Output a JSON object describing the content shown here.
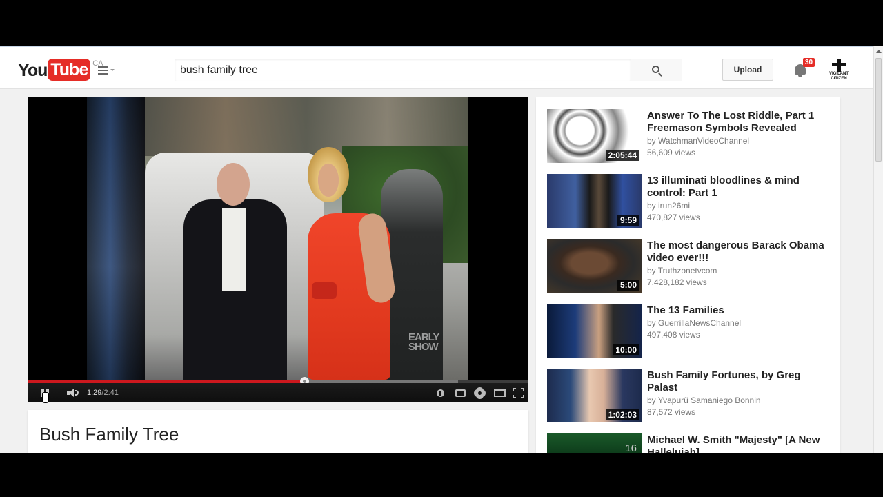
{
  "header": {
    "logo_you": "You",
    "logo_tube": "Tube",
    "region": "CA",
    "search_value": "bush family tree",
    "upload_label": "Upload",
    "notifications_count": "30",
    "avatar_text": "VIGILANT CITIZEN"
  },
  "player": {
    "current_time": "1:29",
    "separator": " / ",
    "duration": "2:41",
    "played_fraction": 0.553,
    "buffered_fraction": 0.86,
    "overlay_logo_line1": "EARLY",
    "overlay_logo_line2": "SHOW",
    "colors": {
      "played": "#cc181e",
      "buffer": "#777777"
    }
  },
  "video": {
    "title": "Bush Family Tree"
  },
  "related": [
    {
      "title": "Answer To The Lost Riddle, Part 1 Freemason Symbols Revealed",
      "channel": "by WatchmanVideoChannel",
      "views": "56,609 views",
      "duration": "2:05:44"
    },
    {
      "title": "13 illuminati bloodlines & mind control: Part 1",
      "channel": "by irun26mi",
      "views": "470,827 views",
      "duration": "9:59"
    },
    {
      "title": "The most dangerous Barack Obama video ever!!!",
      "channel": "by Truthzonetvcom",
      "views": "7,428,182 views",
      "duration": "5:00"
    },
    {
      "title": "The 13 Families",
      "channel": "by GuerrillaNewsChannel",
      "views": "497,408 views",
      "duration": "10:00"
    },
    {
      "title": "Bush Family Fortunes, by Greg Palast",
      "channel": "by Yvapurũ Samaniego Bonnin",
      "views": "87,572 views",
      "duration": "1:02:03"
    },
    {
      "title": "Michael W. Smith \"Majesty\" [A New Hallelujah]",
      "channel": "",
      "views": "",
      "duration": "16"
    }
  ],
  "colors": {
    "brand_red": "#e52d27",
    "page_bg": "#f1f1f1"
  }
}
